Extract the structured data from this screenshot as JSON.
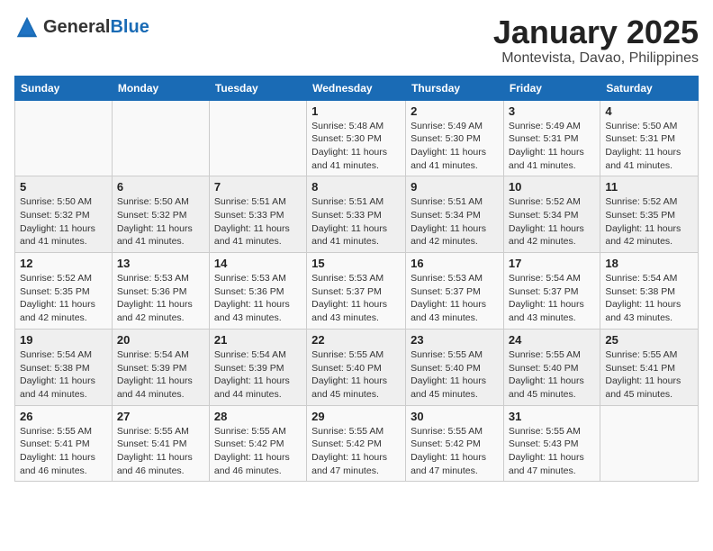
{
  "logo": {
    "general": "General",
    "blue": "Blue"
  },
  "header": {
    "month": "January 2025",
    "location": "Montevista, Davao, Philippines"
  },
  "weekdays": [
    "Sunday",
    "Monday",
    "Tuesday",
    "Wednesday",
    "Thursday",
    "Friday",
    "Saturday"
  ],
  "weeks": [
    [
      {
        "day": "",
        "sunrise": "",
        "sunset": "",
        "daylight": ""
      },
      {
        "day": "",
        "sunrise": "",
        "sunset": "",
        "daylight": ""
      },
      {
        "day": "",
        "sunrise": "",
        "sunset": "",
        "daylight": ""
      },
      {
        "day": "1",
        "sunrise": "Sunrise: 5:48 AM",
        "sunset": "Sunset: 5:30 PM",
        "daylight": "Daylight: 11 hours and 41 minutes."
      },
      {
        "day": "2",
        "sunrise": "Sunrise: 5:49 AM",
        "sunset": "Sunset: 5:30 PM",
        "daylight": "Daylight: 11 hours and 41 minutes."
      },
      {
        "day": "3",
        "sunrise": "Sunrise: 5:49 AM",
        "sunset": "Sunset: 5:31 PM",
        "daylight": "Daylight: 11 hours and 41 minutes."
      },
      {
        "day": "4",
        "sunrise": "Sunrise: 5:50 AM",
        "sunset": "Sunset: 5:31 PM",
        "daylight": "Daylight: 11 hours and 41 minutes."
      }
    ],
    [
      {
        "day": "5",
        "sunrise": "Sunrise: 5:50 AM",
        "sunset": "Sunset: 5:32 PM",
        "daylight": "Daylight: 11 hours and 41 minutes."
      },
      {
        "day": "6",
        "sunrise": "Sunrise: 5:50 AM",
        "sunset": "Sunset: 5:32 PM",
        "daylight": "Daylight: 11 hours and 41 minutes."
      },
      {
        "day": "7",
        "sunrise": "Sunrise: 5:51 AM",
        "sunset": "Sunset: 5:33 PM",
        "daylight": "Daylight: 11 hours and 41 minutes."
      },
      {
        "day": "8",
        "sunrise": "Sunrise: 5:51 AM",
        "sunset": "Sunset: 5:33 PM",
        "daylight": "Daylight: 11 hours and 41 minutes."
      },
      {
        "day": "9",
        "sunrise": "Sunrise: 5:51 AM",
        "sunset": "Sunset: 5:34 PM",
        "daylight": "Daylight: 11 hours and 42 minutes."
      },
      {
        "day": "10",
        "sunrise": "Sunrise: 5:52 AM",
        "sunset": "Sunset: 5:34 PM",
        "daylight": "Daylight: 11 hours and 42 minutes."
      },
      {
        "day": "11",
        "sunrise": "Sunrise: 5:52 AM",
        "sunset": "Sunset: 5:35 PM",
        "daylight": "Daylight: 11 hours and 42 minutes."
      }
    ],
    [
      {
        "day": "12",
        "sunrise": "Sunrise: 5:52 AM",
        "sunset": "Sunset: 5:35 PM",
        "daylight": "Daylight: 11 hours and 42 minutes."
      },
      {
        "day": "13",
        "sunrise": "Sunrise: 5:53 AM",
        "sunset": "Sunset: 5:36 PM",
        "daylight": "Daylight: 11 hours and 42 minutes."
      },
      {
        "day": "14",
        "sunrise": "Sunrise: 5:53 AM",
        "sunset": "Sunset: 5:36 PM",
        "daylight": "Daylight: 11 hours and 43 minutes."
      },
      {
        "day": "15",
        "sunrise": "Sunrise: 5:53 AM",
        "sunset": "Sunset: 5:37 PM",
        "daylight": "Daylight: 11 hours and 43 minutes."
      },
      {
        "day": "16",
        "sunrise": "Sunrise: 5:53 AM",
        "sunset": "Sunset: 5:37 PM",
        "daylight": "Daylight: 11 hours and 43 minutes."
      },
      {
        "day": "17",
        "sunrise": "Sunrise: 5:54 AM",
        "sunset": "Sunset: 5:37 PM",
        "daylight": "Daylight: 11 hours and 43 minutes."
      },
      {
        "day": "18",
        "sunrise": "Sunrise: 5:54 AM",
        "sunset": "Sunset: 5:38 PM",
        "daylight": "Daylight: 11 hours and 43 minutes."
      }
    ],
    [
      {
        "day": "19",
        "sunrise": "Sunrise: 5:54 AM",
        "sunset": "Sunset: 5:38 PM",
        "daylight": "Daylight: 11 hours and 44 minutes."
      },
      {
        "day": "20",
        "sunrise": "Sunrise: 5:54 AM",
        "sunset": "Sunset: 5:39 PM",
        "daylight": "Daylight: 11 hours and 44 minutes."
      },
      {
        "day": "21",
        "sunrise": "Sunrise: 5:54 AM",
        "sunset": "Sunset: 5:39 PM",
        "daylight": "Daylight: 11 hours and 44 minutes."
      },
      {
        "day": "22",
        "sunrise": "Sunrise: 5:55 AM",
        "sunset": "Sunset: 5:40 PM",
        "daylight": "Daylight: 11 hours and 45 minutes."
      },
      {
        "day": "23",
        "sunrise": "Sunrise: 5:55 AM",
        "sunset": "Sunset: 5:40 PM",
        "daylight": "Daylight: 11 hours and 45 minutes."
      },
      {
        "day": "24",
        "sunrise": "Sunrise: 5:55 AM",
        "sunset": "Sunset: 5:40 PM",
        "daylight": "Daylight: 11 hours and 45 minutes."
      },
      {
        "day": "25",
        "sunrise": "Sunrise: 5:55 AM",
        "sunset": "Sunset: 5:41 PM",
        "daylight": "Daylight: 11 hours and 45 minutes."
      }
    ],
    [
      {
        "day": "26",
        "sunrise": "Sunrise: 5:55 AM",
        "sunset": "Sunset: 5:41 PM",
        "daylight": "Daylight: 11 hours and 46 minutes."
      },
      {
        "day": "27",
        "sunrise": "Sunrise: 5:55 AM",
        "sunset": "Sunset: 5:41 PM",
        "daylight": "Daylight: 11 hours and 46 minutes."
      },
      {
        "day": "28",
        "sunrise": "Sunrise: 5:55 AM",
        "sunset": "Sunset: 5:42 PM",
        "daylight": "Daylight: 11 hours and 46 minutes."
      },
      {
        "day": "29",
        "sunrise": "Sunrise: 5:55 AM",
        "sunset": "Sunset: 5:42 PM",
        "daylight": "Daylight: 11 hours and 47 minutes."
      },
      {
        "day": "30",
        "sunrise": "Sunrise: 5:55 AM",
        "sunset": "Sunset: 5:42 PM",
        "daylight": "Daylight: 11 hours and 47 minutes."
      },
      {
        "day": "31",
        "sunrise": "Sunrise: 5:55 AM",
        "sunset": "Sunset: 5:43 PM",
        "daylight": "Daylight: 11 hours and 47 minutes."
      },
      {
        "day": "",
        "sunrise": "",
        "sunset": "",
        "daylight": ""
      }
    ]
  ]
}
